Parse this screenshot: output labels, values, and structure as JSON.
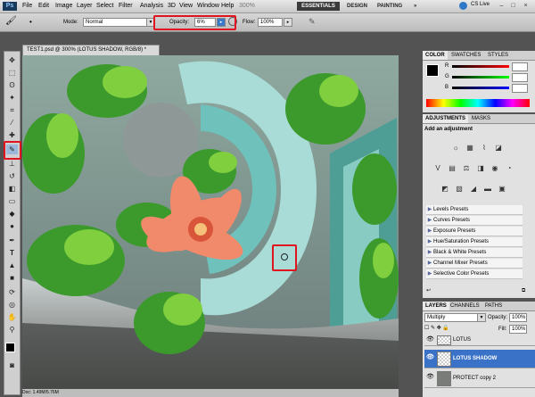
{
  "menubar": {
    "logo": "Ps",
    "items": [
      "File",
      "Edit",
      "Image",
      "Layer",
      "Select",
      "Filter",
      "Analysis",
      "3D",
      "View",
      "Window",
      "Help"
    ],
    "zoom": "300%",
    "workspaces": [
      "ESSENTIALS",
      "DESIGN",
      "PAINTING"
    ],
    "more": "»",
    "cs_live": "CS Live",
    "window_controls": [
      "–",
      "□",
      "×"
    ]
  },
  "options_bar": {
    "mode_label": "Mode:",
    "mode_value": "Normal",
    "opacity_label": "Opacity:",
    "opacity_value": "6%",
    "flow_label": "Flow:",
    "flow_value": "100%"
  },
  "document": {
    "tab_title": "TEST1.psd @ 300% (LOTUS SHADOW, RGB/8) *",
    "status": "Doc: 1.49M/5.76M"
  },
  "color_panel": {
    "tabs": [
      "COLOR",
      "SWATCHES",
      "STYLES"
    ],
    "channels": [
      {
        "label": "R",
        "value": ""
      },
      {
        "label": "G",
        "value": ""
      },
      {
        "label": "B",
        "value": ""
      }
    ]
  },
  "adjustments_panel": {
    "tabs": [
      "ADJUSTMENTS",
      "MASKS"
    ],
    "heading": "Add an adjustment",
    "presets": [
      "Levels Presets",
      "Curves Presets",
      "Exposure Presets",
      "Hue/Saturation Presets",
      "Black & White Presets",
      "Channel Mixer Presets",
      "Selective Color Presets"
    ]
  },
  "layers_panel": {
    "tabs": [
      "LAYERS",
      "CHANNELS",
      "PATHS"
    ],
    "blend_mode": "Multiply",
    "opacity_label": "Opacity:",
    "opacity_value": "100%",
    "fill_label": "Fill:",
    "fill_value": "100%",
    "layers": [
      {
        "name": "LOTUS",
        "selected": false
      },
      {
        "name": "LOTUS SHADOW",
        "selected": true
      },
      {
        "name": "PROTECT copy 2",
        "selected": false
      }
    ]
  },
  "colors": {
    "highlight_box": "#e0141e",
    "selected_layer": "#3a72c8",
    "workspace_active": "#3b3b3b"
  }
}
